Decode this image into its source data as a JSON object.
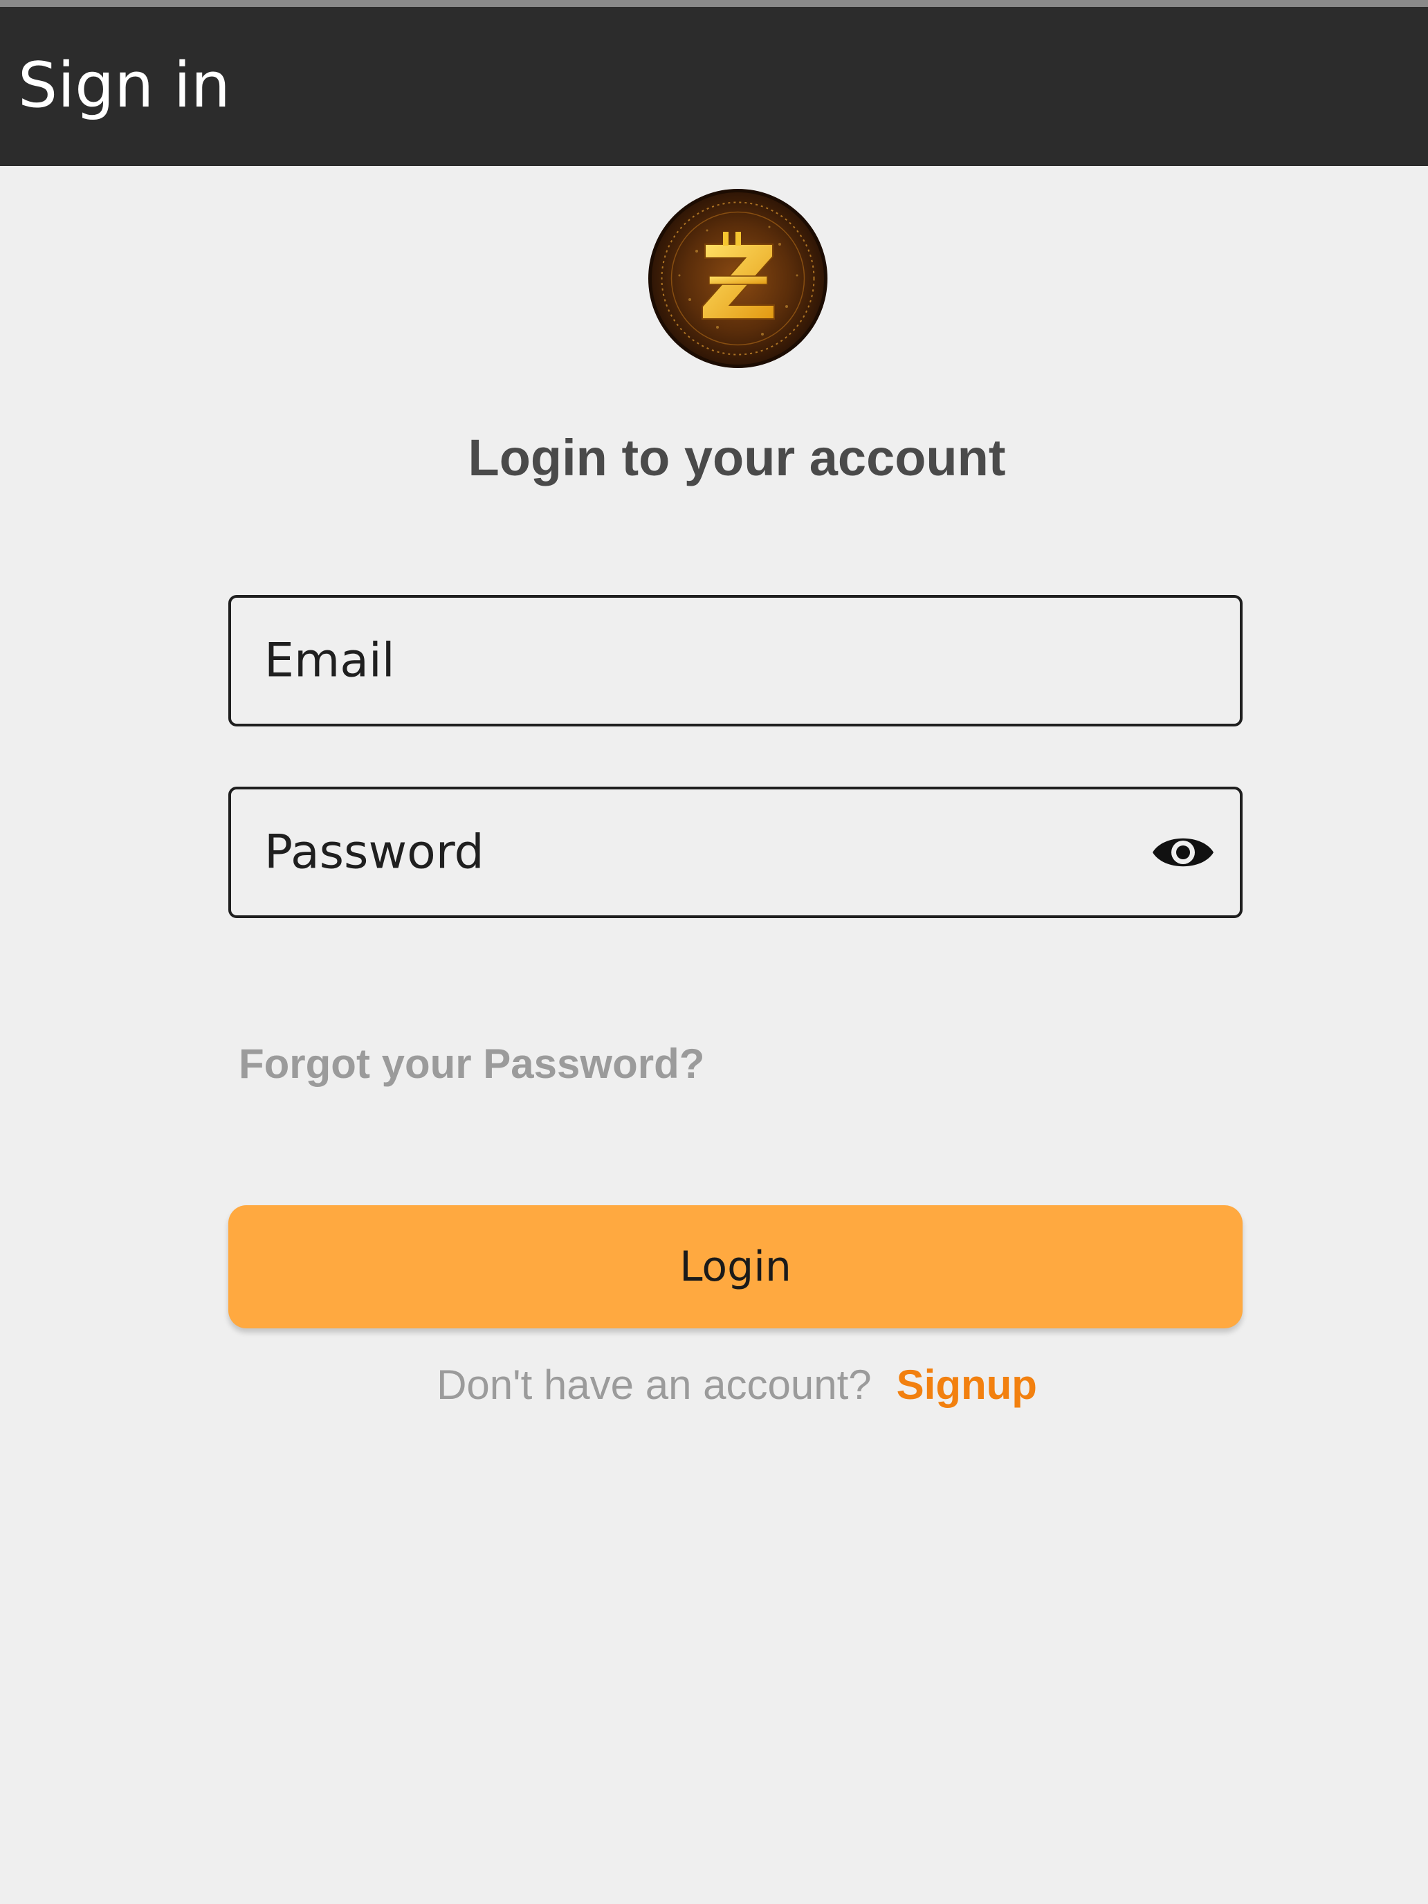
{
  "app_bar": {
    "title": "Sign in",
    "background": "#2c2c2c"
  },
  "logo": {
    "icon": "z-coin-logo",
    "colors": [
      "#4a2408",
      "#f5c530"
    ]
  },
  "heading": "Login to your account",
  "form": {
    "email": {
      "label": "Email",
      "value": ""
    },
    "password": {
      "label": "Password",
      "value": "",
      "toggle_icon": "eye-icon"
    },
    "forgot_password": "Forgot your Password?",
    "login_button": "Login",
    "signup_prompt": "Don't have an account?",
    "signup_link": "Signup"
  },
  "colors": {
    "accent": "#ffa940",
    "link": "#f2800f",
    "background": "#efefef"
  }
}
